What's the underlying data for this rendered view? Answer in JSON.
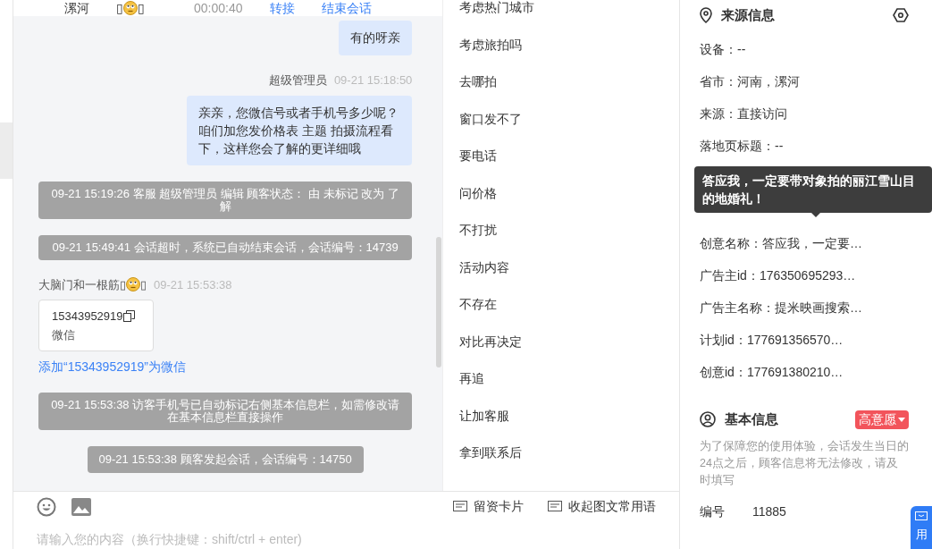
{
  "chat_header": {
    "location": "漯河",
    "name_marks": [
      "▯",
      "▯"
    ],
    "duration": "00:00:40",
    "actions": [
      "转接",
      "结束会话"
    ]
  },
  "messages": [
    {
      "kind": "agent_bubble",
      "text": "有的呀亲"
    },
    {
      "kind": "agent",
      "sender": "超级管理员",
      "time": "09-21 15:18:50",
      "text": "亲亲，您微信号或者手机号多少呢？咱们加您发价格表 主题 拍摄流程看下，这样您会了解的更详细哦"
    },
    {
      "kind": "system",
      "text": "09-21 15:19:26 客服 超级管理员 编辑 顾客状态： 由 未标记 改为 了解"
    },
    {
      "kind": "system",
      "text": "09-21 15:49:41 会话超时，系统已自动结束会话，会话编号：14739"
    },
    {
      "kind": "customer_card",
      "sender": "大脑门和一根筋",
      "sender_marks": [
        "▯",
        "▯"
      ],
      "time": "09-21 15:53:38",
      "card_value": "15343952919",
      "card_label": "微信",
      "link": "添加“15343952919”为微信"
    },
    {
      "kind": "system",
      "text": "09-21 15:53:38 访客手机号已自动标记右侧基本信息栏，如需修改请在基本信息栏直接操作"
    },
    {
      "kind": "system_short",
      "text": "09-21 15:53:38 顾客发起会话，会话编号：14750"
    }
  ],
  "composer": {
    "placeholder": "请输入您的内容（换行快捷键：shift/ctrl + enter)"
  },
  "quick_phrases": [
    "考虑热门城市",
    "考虑旅拍吗",
    "去哪拍",
    "窗口发不了",
    "要电话",
    "问价格",
    "不打扰",
    "活动内容",
    "不存在",
    "对比再决定",
    "再追",
    "让加客服",
    "拿到联系后"
  ],
  "phrase_actions": [
    "留资卡片",
    "收起图文常用语"
  ],
  "source_info": {
    "title": "来源信息",
    "rows": [
      {
        "kind": "row",
        "text": "设备：--"
      },
      {
        "kind": "row",
        "text": "省市：河南，漯河"
      },
      {
        "kind": "row",
        "text": "来源：直接访问"
      },
      {
        "kind": "row",
        "text": "落地页标题：--"
      },
      {
        "kind": "tooltip",
        "text": "答应我，一定要带对象拍的丽江雪山目的地婚礼！"
      },
      {
        "kind": "row",
        "text": "创意名称：答应我，一定要…"
      },
      {
        "kind": "row",
        "text": "广告主id：176350695293…"
      },
      {
        "kind": "row",
        "text": "广告主名称：提米映画搜索…"
      },
      {
        "kind": "row",
        "text": "计划id：177691356570…"
      },
      {
        "kind": "row",
        "text": "创意id：177691380210…"
      }
    ]
  },
  "basic_info": {
    "title": "基本信息",
    "intent": "高意愿",
    "notice": "为了保障您的使用体验，会话发生当日的24点之后，顾客信息将无法修改，请及时填写",
    "fields": [
      {
        "label": "编号",
        "value": "11885"
      }
    ]
  },
  "float_button": {
    "label": "用"
  }
}
